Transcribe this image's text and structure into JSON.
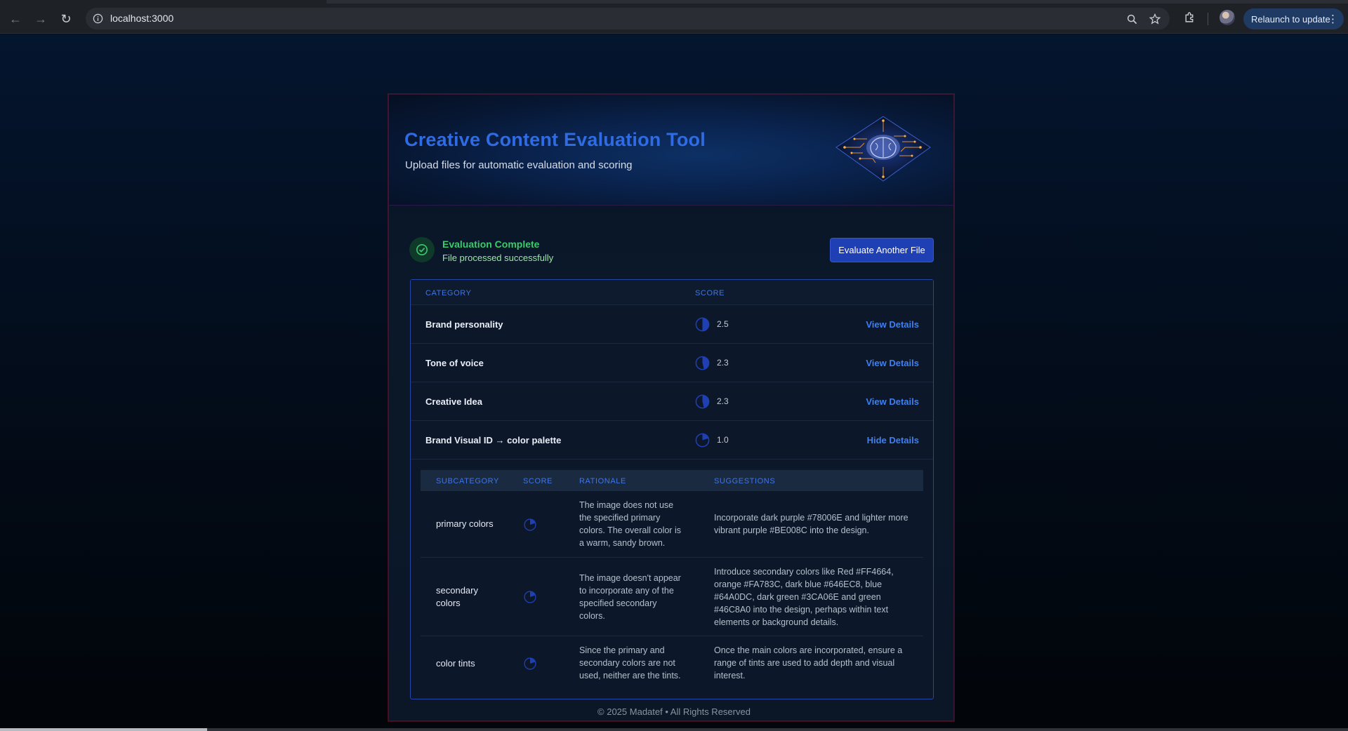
{
  "browser": {
    "url": "localhost:3000",
    "relaunch_label": "Relaunch to update"
  },
  "hero": {
    "title": "Creative Content Evaluation Tool",
    "subtitle": "Upload files for automatic evaluation and scoring"
  },
  "status": {
    "title": "Evaluation Complete",
    "subtitle": "File processed successfully",
    "button_label": "Evaluate Another File",
    "color": "#3ec96d"
  },
  "table": {
    "headers": {
      "category": "CATEGORY",
      "score": "SCORE"
    },
    "rows": [
      {
        "category": "Brand personality",
        "score": "2.5",
        "fill": 0.5,
        "link": "View Details"
      },
      {
        "category": "Tone of voice",
        "score": "2.3",
        "fill": 0.46,
        "link": "View Details"
      },
      {
        "category": "Creative Idea",
        "score": "2.3",
        "fill": 0.46,
        "link": "View Details"
      },
      {
        "category": "Brand Visual ID → color palette",
        "score": "1.0",
        "fill": 0.2,
        "link": "Hide Details"
      }
    ]
  },
  "details": {
    "headers": {
      "subcategory": "SUBCATEGORY",
      "score": "SCORE",
      "rationale": "RATIONALE",
      "suggestions": "SUGGESTIONS"
    },
    "rows": [
      {
        "subcategory": "primary colors",
        "fill": 0.2,
        "rationale": "The image does not use the specified primary colors. The overall color is a warm, sandy brown.",
        "suggestions": "Incorporate dark purple #78006E and lighter more vibrant purple #BE008C into the design."
      },
      {
        "subcategory": "secondary colors",
        "fill": 0.2,
        "rationale": "The image doesn't appear to incorporate any of the specified secondary colors.",
        "suggestions": "Introduce secondary colors like Red #FF4664, orange #FA783C, dark blue #646EC8, blue #64A0DC, dark green #3CA06E and green #46C8A0 into the design, perhaps within text elements or background details."
      },
      {
        "subcategory": "color tints",
        "fill": 0.2,
        "rationale": "Since the primary and secondary colors are not used, neither are the tints.",
        "suggestions": "Once the main colors are incorporated, ensure a range of tints are used to add depth and visual interest."
      }
    ]
  },
  "footer": {
    "text": "© 2025 Madatef • All Rights Reserved"
  },
  "colors": {
    "accent": "#2f6be3",
    "link": "#3f7ff0",
    "pie_fill": "#1f3fb5"
  }
}
